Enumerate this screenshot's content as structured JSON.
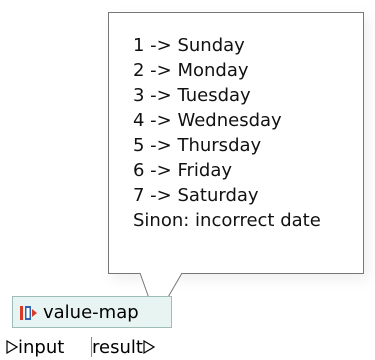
{
  "tooltip": {
    "lines": [
      "1 -> Sunday",
      "2 -> Monday",
      "3 -> Tuesday",
      "4 -> Wednesday",
      "5 -> Thursday",
      "6 -> Friday",
      "7 -> Saturday",
      "Sinon: incorrect date"
    ]
  },
  "component": {
    "title": "value-map",
    "icon": "value-map-icon"
  },
  "ports": {
    "input_label": "input",
    "output_label": "result"
  },
  "colors": {
    "component_bg": "#e8f4f1",
    "component_border": "#9dbdb6",
    "icon_red": "#d93b2b",
    "icon_blue": "#2d64b3"
  }
}
